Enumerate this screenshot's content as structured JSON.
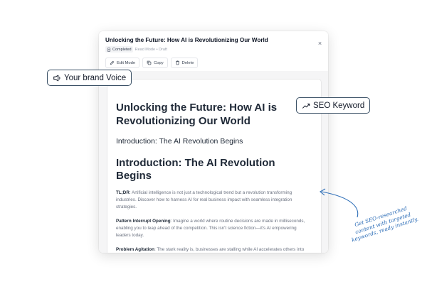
{
  "panel": {
    "title": "Unlocking the Future: How AI is Revolutionizing Our World",
    "status": "Completed",
    "meta": "Read Mode • Draft",
    "close_label": "×",
    "toolbar": {
      "edit_label": "Edit Mode",
      "copy_label": "Copy",
      "delete_label": "Delete"
    }
  },
  "document": {
    "title": "Unlocking the Future: How AI is Revolutionizing Our World",
    "subheading": "Introduction: The AI Revolution Begins",
    "heading": "Introduction: The AI Revolution Begins",
    "paragraphs": [
      {
        "label": "TL;DR",
        "text": ": Artificial intelligence is not just a technological trend but a revolution transforming industries. Discover how to harness AI for real business impact with seamless integration strategies."
      },
      {
        "label": "Pattern Interrupt Opening",
        "text": ": Imagine a world where routine decisions are made in milliseconds, enabling you to leap ahead of the competition. This isn't science fiction—it's AI empowering leaders today."
      },
      {
        "label": "Problem Agitation",
        "text": ": The stark reality is, businesses are stalling while AI accelerates others into the future. Stay complacent, and risk becoming obsolete."
      }
    ]
  },
  "callouts": {
    "brand_voice": "Your brand Voice",
    "seo_keyword": "SEO Keyword"
  },
  "annotation": {
    "line1": "Get SEO-researched",
    "line2": "content with targeted",
    "line3": "keywords, ready instantly."
  },
  "icons": {
    "status": "document-icon",
    "edit": "pencil-icon",
    "copy": "copy-icon",
    "delete": "trash-icon",
    "brand_voice": "megaphone-icon",
    "seo_keyword": "trend-up-icon"
  },
  "colors": {
    "callout_border": "#3b5166",
    "annotation": "#2f6fb8"
  }
}
